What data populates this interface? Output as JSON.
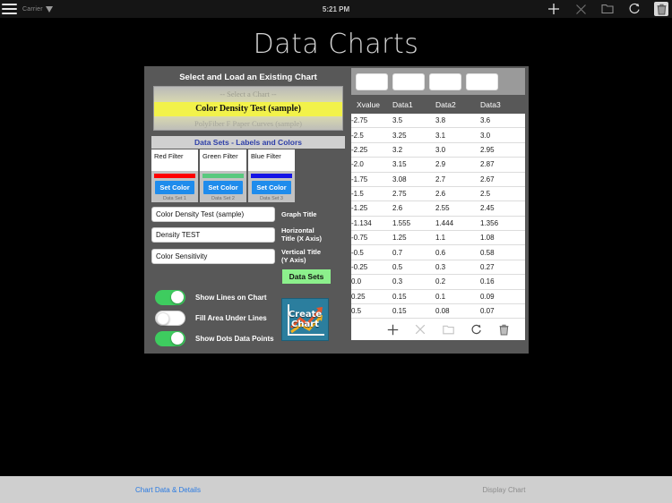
{
  "statusbar": {
    "carrier": "Carrier",
    "time": "5:21 PM",
    "icons": [
      "menu-icon",
      "wifi-icon",
      "add-icon",
      "close-icon",
      "folder-icon",
      "refresh-icon",
      "trash-icon"
    ]
  },
  "app_title": "Data Charts",
  "select_panel": {
    "heading": "Select and Load an Existing Chart",
    "options": [
      "-- Select a Chart --",
      "Color Density Test (sample)",
      "PolyFiber F Paper Curves (sample)"
    ],
    "selected_index": 1
  },
  "datasets_panel": {
    "heading": "Data Sets - Labels and Colors",
    "set_color_label": "Set Color",
    "items": [
      {
        "name": "Red Filter",
        "color": "#ff0000",
        "footer": "Data Set 1"
      },
      {
        "name": "Green Filter",
        "color": "#59c97e",
        "footer": "Data Set 2"
      },
      {
        "name": "Blue Filter",
        "color": "#1414e6",
        "footer": "Data Set 3"
      }
    ]
  },
  "fields": [
    {
      "value": "Color Density Test (sample)",
      "label": "Graph Title",
      "label2": ""
    },
    {
      "value": "Density TEST",
      "label": "Horizontal",
      "label2": "Title    (X Axis)"
    },
    {
      "value": "Color Sensitivity",
      "label": "Vertical Title",
      "label2": "(Y Axis)"
    }
  ],
  "data_sets_button": "Data Sets",
  "toggles": [
    {
      "label": "Show Lines on Chart",
      "on": true
    },
    {
      "label": "Fill Area Under Lines",
      "on": false
    },
    {
      "label": "Show Dots Data Points",
      "on": true
    }
  ],
  "create_chart_button": {
    "line1": "Create",
    "line2": "Chart",
    "color": "#2b7e9e"
  },
  "input_bar": {
    "boxes": [
      "",
      "",
      "",
      ""
    ]
  },
  "table": {
    "columns": [
      "Xvalue",
      "Data1",
      "Data2",
      "Data3"
    ],
    "rows": [
      [
        "-2.75",
        "3.5",
        "3.8",
        "3.6"
      ],
      [
        "-2.5",
        "3.25",
        "3.1",
        "3.0"
      ],
      [
        "-2.25",
        "3.2",
        "3.0",
        "2.95"
      ],
      [
        "-2.0",
        "3.15",
        "2.9",
        "2.87"
      ],
      [
        "-1.75",
        "3.08",
        "2.7",
        "2.67"
      ],
      [
        "-1.5",
        "2.75",
        "2.6",
        "2.5"
      ],
      [
        "-1.25",
        "2.6",
        "2.55",
        "2.45"
      ],
      [
        "-1.134",
        "1.555",
        "1.444",
        "1.356"
      ],
      [
        "-0.75",
        "1.25",
        "1.1",
        "1.08"
      ],
      [
        "-0.5",
        "0.7",
        "0.6",
        "0.58"
      ],
      [
        "-0.25",
        "0.5",
        "0.3",
        "0.27"
      ],
      [
        "0.0",
        "0.3",
        "0.2",
        "0.16"
      ],
      [
        "0.25",
        "0.15",
        "0.1",
        "0.09"
      ],
      [
        "0.5",
        "0.15",
        "0.08",
        "0.07"
      ]
    ],
    "toolbar_icons": [
      "add-icon",
      "close-icon",
      "folder-icon",
      "refresh-icon",
      "trash-icon"
    ]
  },
  "tabbar": {
    "tabs": [
      {
        "label": "Chart Data & Details",
        "active": true
      },
      {
        "label": "Display Chart",
        "active": false
      }
    ],
    "active_color": "#2a7ae2"
  },
  "chart_data": {
    "type": "line",
    "title": "Color Density Test (sample)",
    "xlabel": "Density TEST",
    "ylabel": "Color Sensitivity",
    "x": [
      -2.75,
      -2.5,
      -2.25,
      -2.0,
      -1.75,
      -1.5,
      -1.25,
      -1.134,
      -0.75,
      -0.5,
      -0.25,
      0.0,
      0.25,
      0.5
    ],
    "series": [
      {
        "name": "Red Filter",
        "color": "#ff0000",
        "values": [
          3.5,
          3.25,
          3.2,
          3.15,
          3.08,
          2.75,
          2.6,
          1.555,
          1.25,
          0.7,
          0.5,
          0.3,
          0.15,
          0.15
        ]
      },
      {
        "name": "Green Filter",
        "color": "#59c97e",
        "values": [
          3.8,
          3.1,
          3.0,
          2.9,
          2.7,
          2.6,
          2.55,
          1.444,
          1.1,
          0.6,
          0.3,
          0.2,
          0.1,
          0.08
        ]
      },
      {
        "name": "Blue Filter",
        "color": "#1414e6",
        "values": [
          3.6,
          3.0,
          2.95,
          2.87,
          2.67,
          2.5,
          2.45,
          1.356,
          1.08,
          0.58,
          0.27,
          0.16,
          0.09,
          0.07
        ]
      }
    ],
    "legend": [
      "Red Filter",
      "Green Filter",
      "Blue Filter"
    ],
    "grid": false
  }
}
